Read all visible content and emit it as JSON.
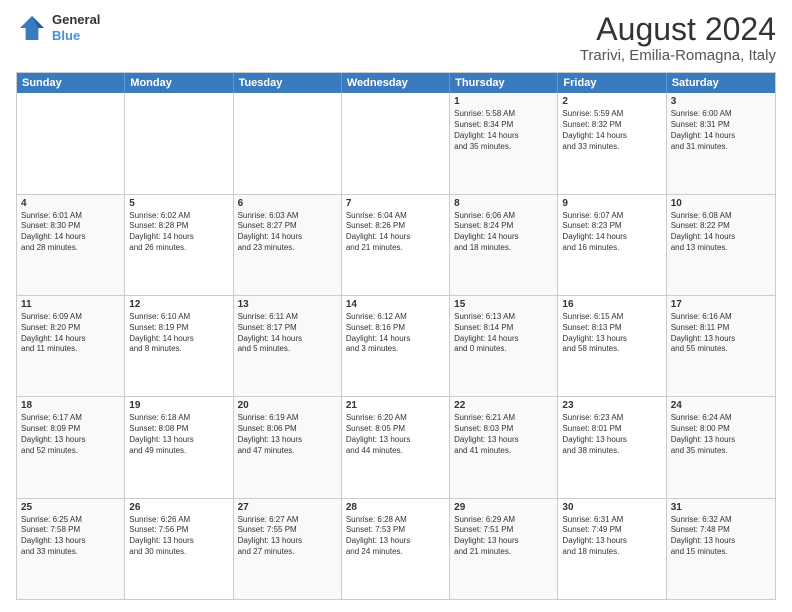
{
  "logo": {
    "general": "General",
    "blue": "Blue"
  },
  "title": "August 2024",
  "subtitle": "Trarivi, Emilia-Romagna, Italy",
  "days": [
    "Sunday",
    "Monday",
    "Tuesday",
    "Wednesday",
    "Thursday",
    "Friday",
    "Saturday"
  ],
  "rows": [
    [
      {
        "day": "",
        "text": ""
      },
      {
        "day": "",
        "text": ""
      },
      {
        "day": "",
        "text": ""
      },
      {
        "day": "",
        "text": ""
      },
      {
        "day": "1",
        "text": "Sunrise: 5:58 AM\nSunset: 8:34 PM\nDaylight: 14 hours\nand 35 minutes."
      },
      {
        "day": "2",
        "text": "Sunrise: 5:59 AM\nSunset: 8:32 PM\nDaylight: 14 hours\nand 33 minutes."
      },
      {
        "day": "3",
        "text": "Sunrise: 6:00 AM\nSunset: 8:31 PM\nDaylight: 14 hours\nand 31 minutes."
      }
    ],
    [
      {
        "day": "4",
        "text": "Sunrise: 6:01 AM\nSunset: 8:30 PM\nDaylight: 14 hours\nand 28 minutes."
      },
      {
        "day": "5",
        "text": "Sunrise: 6:02 AM\nSunset: 8:28 PM\nDaylight: 14 hours\nand 26 minutes."
      },
      {
        "day": "6",
        "text": "Sunrise: 6:03 AM\nSunset: 8:27 PM\nDaylight: 14 hours\nand 23 minutes."
      },
      {
        "day": "7",
        "text": "Sunrise: 6:04 AM\nSunset: 8:26 PM\nDaylight: 14 hours\nand 21 minutes."
      },
      {
        "day": "8",
        "text": "Sunrise: 6:06 AM\nSunset: 8:24 PM\nDaylight: 14 hours\nand 18 minutes."
      },
      {
        "day": "9",
        "text": "Sunrise: 6:07 AM\nSunset: 8:23 PM\nDaylight: 14 hours\nand 16 minutes."
      },
      {
        "day": "10",
        "text": "Sunrise: 6:08 AM\nSunset: 8:22 PM\nDaylight: 14 hours\nand 13 minutes."
      }
    ],
    [
      {
        "day": "11",
        "text": "Sunrise: 6:09 AM\nSunset: 8:20 PM\nDaylight: 14 hours\nand 11 minutes."
      },
      {
        "day": "12",
        "text": "Sunrise: 6:10 AM\nSunset: 8:19 PM\nDaylight: 14 hours\nand 8 minutes."
      },
      {
        "day": "13",
        "text": "Sunrise: 6:11 AM\nSunset: 8:17 PM\nDaylight: 14 hours\nand 5 minutes."
      },
      {
        "day": "14",
        "text": "Sunrise: 6:12 AM\nSunset: 8:16 PM\nDaylight: 14 hours\nand 3 minutes."
      },
      {
        "day": "15",
        "text": "Sunrise: 6:13 AM\nSunset: 8:14 PM\nDaylight: 14 hours\nand 0 minutes."
      },
      {
        "day": "16",
        "text": "Sunrise: 6:15 AM\nSunset: 8:13 PM\nDaylight: 13 hours\nand 58 minutes."
      },
      {
        "day": "17",
        "text": "Sunrise: 6:16 AM\nSunset: 8:11 PM\nDaylight: 13 hours\nand 55 minutes."
      }
    ],
    [
      {
        "day": "18",
        "text": "Sunrise: 6:17 AM\nSunset: 8:09 PM\nDaylight: 13 hours\nand 52 minutes."
      },
      {
        "day": "19",
        "text": "Sunrise: 6:18 AM\nSunset: 8:08 PM\nDaylight: 13 hours\nand 49 minutes."
      },
      {
        "day": "20",
        "text": "Sunrise: 6:19 AM\nSunset: 8:06 PM\nDaylight: 13 hours\nand 47 minutes."
      },
      {
        "day": "21",
        "text": "Sunrise: 6:20 AM\nSunset: 8:05 PM\nDaylight: 13 hours\nand 44 minutes."
      },
      {
        "day": "22",
        "text": "Sunrise: 6:21 AM\nSunset: 8:03 PM\nDaylight: 13 hours\nand 41 minutes."
      },
      {
        "day": "23",
        "text": "Sunrise: 6:23 AM\nSunset: 8:01 PM\nDaylight: 13 hours\nand 38 minutes."
      },
      {
        "day": "24",
        "text": "Sunrise: 6:24 AM\nSunset: 8:00 PM\nDaylight: 13 hours\nand 35 minutes."
      }
    ],
    [
      {
        "day": "25",
        "text": "Sunrise: 6:25 AM\nSunset: 7:58 PM\nDaylight: 13 hours\nand 33 minutes."
      },
      {
        "day": "26",
        "text": "Sunrise: 6:26 AM\nSunset: 7:56 PM\nDaylight: 13 hours\nand 30 minutes."
      },
      {
        "day": "27",
        "text": "Sunrise: 6:27 AM\nSunset: 7:55 PM\nDaylight: 13 hours\nand 27 minutes."
      },
      {
        "day": "28",
        "text": "Sunrise: 6:28 AM\nSunset: 7:53 PM\nDaylight: 13 hours\nand 24 minutes."
      },
      {
        "day": "29",
        "text": "Sunrise: 6:29 AM\nSunset: 7:51 PM\nDaylight: 13 hours\nand 21 minutes."
      },
      {
        "day": "30",
        "text": "Sunrise: 6:31 AM\nSunset: 7:49 PM\nDaylight: 13 hours\nand 18 minutes."
      },
      {
        "day": "31",
        "text": "Sunrise: 6:32 AM\nSunset: 7:48 PM\nDaylight: 13 hours\nand 15 minutes."
      }
    ]
  ]
}
